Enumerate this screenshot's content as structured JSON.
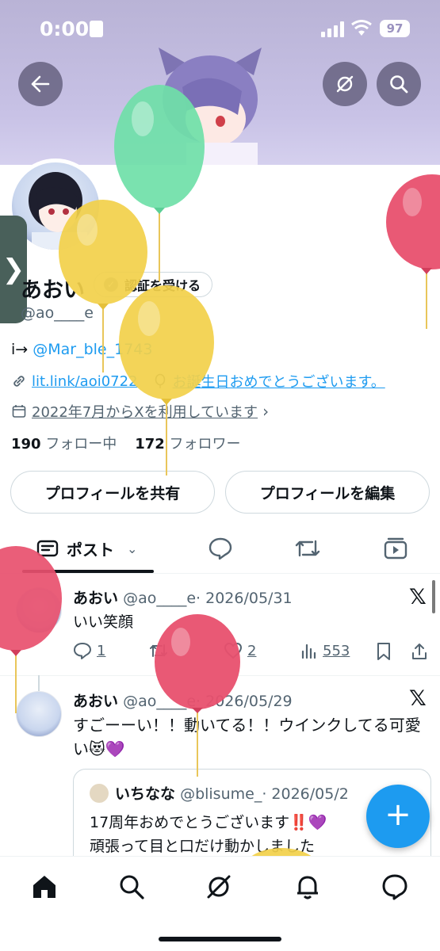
{
  "status_bar": {
    "time": "0:00",
    "battery": "97"
  },
  "profile": {
    "display_name": "あおい",
    "verify_label": "認証を受ける",
    "handle": "@ao____e",
    "bio_prefix": "i→ ",
    "bio_link": "@Mar_ble_1743",
    "website": "lit.link/aoi0722",
    "birthday": "お誕生日おめでとうございます。",
    "joined": "2022年7月からXを利用しています",
    "following_count": "190",
    "following_label": "フォロー中",
    "followers_count": "172",
    "followers_label": "フォロワー"
  },
  "buttons": {
    "share_profile": "プロフィールを共有",
    "edit_profile": "プロフィールを編集"
  },
  "tabs": {
    "posts": "ポスト"
  },
  "posts": [
    {
      "name": "あおい",
      "handle": "@ao____e",
      "date": "· 2026/05/31",
      "text": "いい笑顔",
      "replies": "1",
      "likes": "2",
      "views": "553"
    },
    {
      "name": "あおい",
      "handle": "@ao____e",
      "date": "· 2026/05/29",
      "text": "すごーーい！！動いてる！！ウインクしてる可愛い😻💜",
      "quote": {
        "name": "いちなな",
        "handle": "@blisume_",
        "date": "· 2026/05/2",
        "text_line1": "17周年おめでとうございます‼️💜",
        "text_line2": "頑張って目と口だけ動かしました"
      }
    }
  ],
  "colors": {
    "accent": "#1d9bf0",
    "banner": "#c8c2e6",
    "balloon_green": "#6fe0a8",
    "balloon_yellow": "#f2d04a",
    "balloon_red": "#e8506e"
  },
  "icons": [
    "back-arrow-icon",
    "grok-icon",
    "search-icon",
    "x-logo-icon",
    "reply-icon",
    "repost-icon",
    "like-icon",
    "views-icon",
    "bookmark-icon",
    "share-icon",
    "home-icon",
    "notifications-icon",
    "messages-icon",
    "compose-icon"
  ]
}
